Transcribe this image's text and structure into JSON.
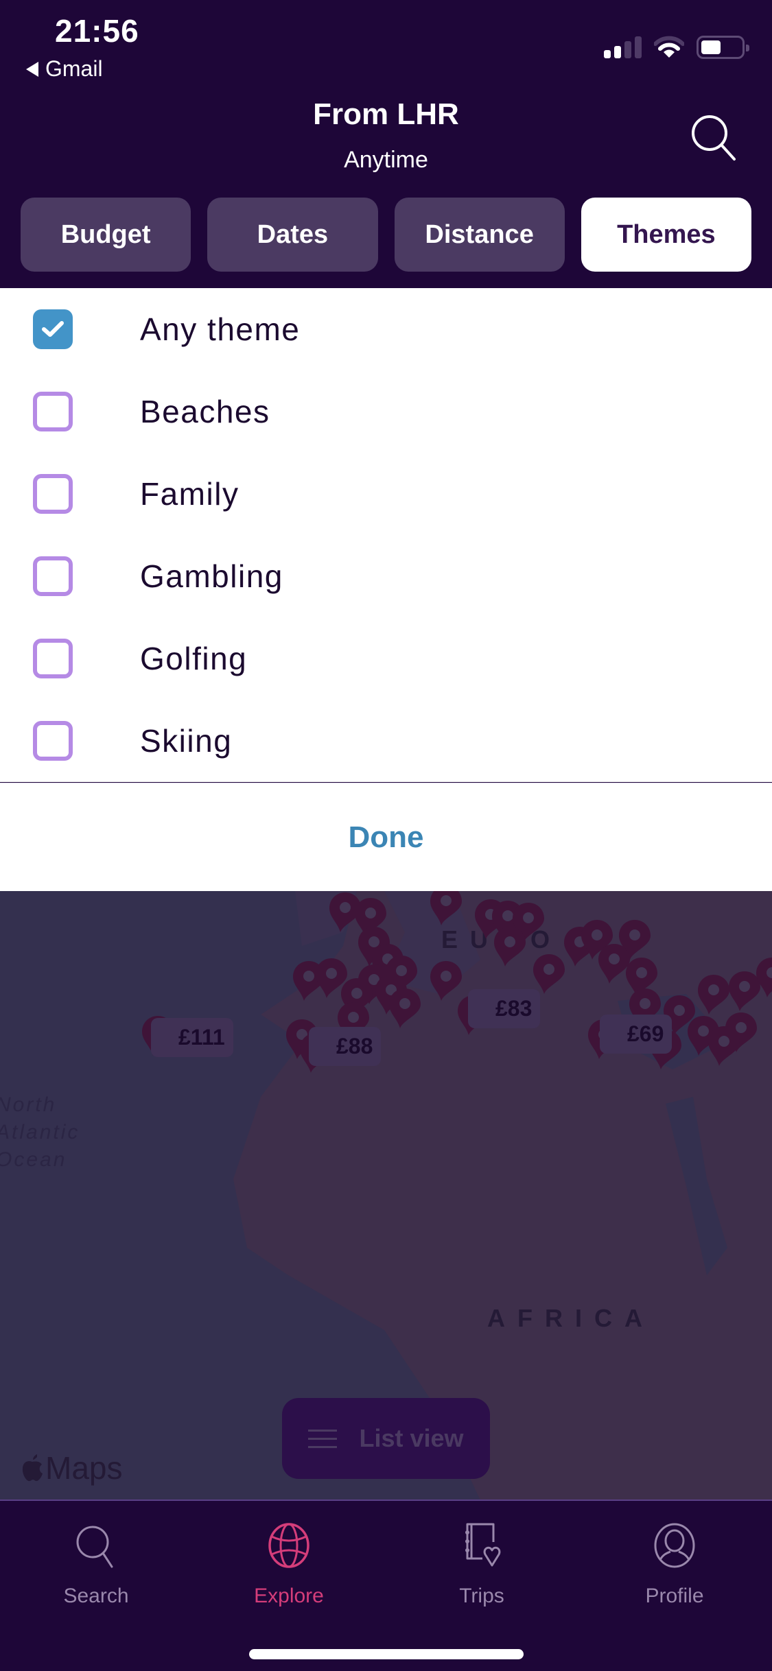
{
  "status_bar": {
    "time": "21:56",
    "back_app": "Gmail",
    "signal_bars_active": 2,
    "signal_bars_total": 4,
    "battery_level_percent": 40
  },
  "header": {
    "title": "From LHR",
    "subtitle": "Anytime",
    "search_icon": "search-icon"
  },
  "filter_tabs": [
    {
      "label": "Budget",
      "active": false
    },
    {
      "label": "Dates",
      "active": false
    },
    {
      "label": "Distance",
      "active": false
    },
    {
      "label": "Themes",
      "active": true
    }
  ],
  "themes": {
    "options": [
      {
        "label": "Any theme",
        "checked": true
      },
      {
        "label": "Beaches",
        "checked": false
      },
      {
        "label": "Family",
        "checked": false
      },
      {
        "label": "Gambling",
        "checked": false
      },
      {
        "label": "Golfing",
        "checked": false
      },
      {
        "label": "Skiing",
        "checked": false
      }
    ],
    "done_label": "Done"
  },
  "map": {
    "price_labels": [
      "£111",
      "£88",
      "£83",
      "£69"
    ],
    "region_labels": {
      "europe": "EUROPE",
      "africa": "AFRICA",
      "ocean": [
        "North",
        "Atlantic",
        "Ocean"
      ]
    },
    "attribution": "Maps",
    "list_view_label": "List view"
  },
  "bottom_nav": [
    {
      "label": "Search",
      "icon": "search-icon",
      "active": false
    },
    {
      "label": "Explore",
      "icon": "globe-icon",
      "active": true
    },
    {
      "label": "Trips",
      "icon": "trips-notebook-heart-icon",
      "active": false
    },
    {
      "label": "Profile",
      "icon": "profile-icon",
      "active": false
    }
  ],
  "colors": {
    "header_bg": "#1e0638",
    "tab_inactive": "#4b3a62",
    "checkbox_checked": "#4394c8",
    "checkbox_border": "#b58ae5",
    "done_text": "#3b85b4",
    "nav_active": "#d53d7a",
    "nav_inactive": "#9a88ac"
  }
}
